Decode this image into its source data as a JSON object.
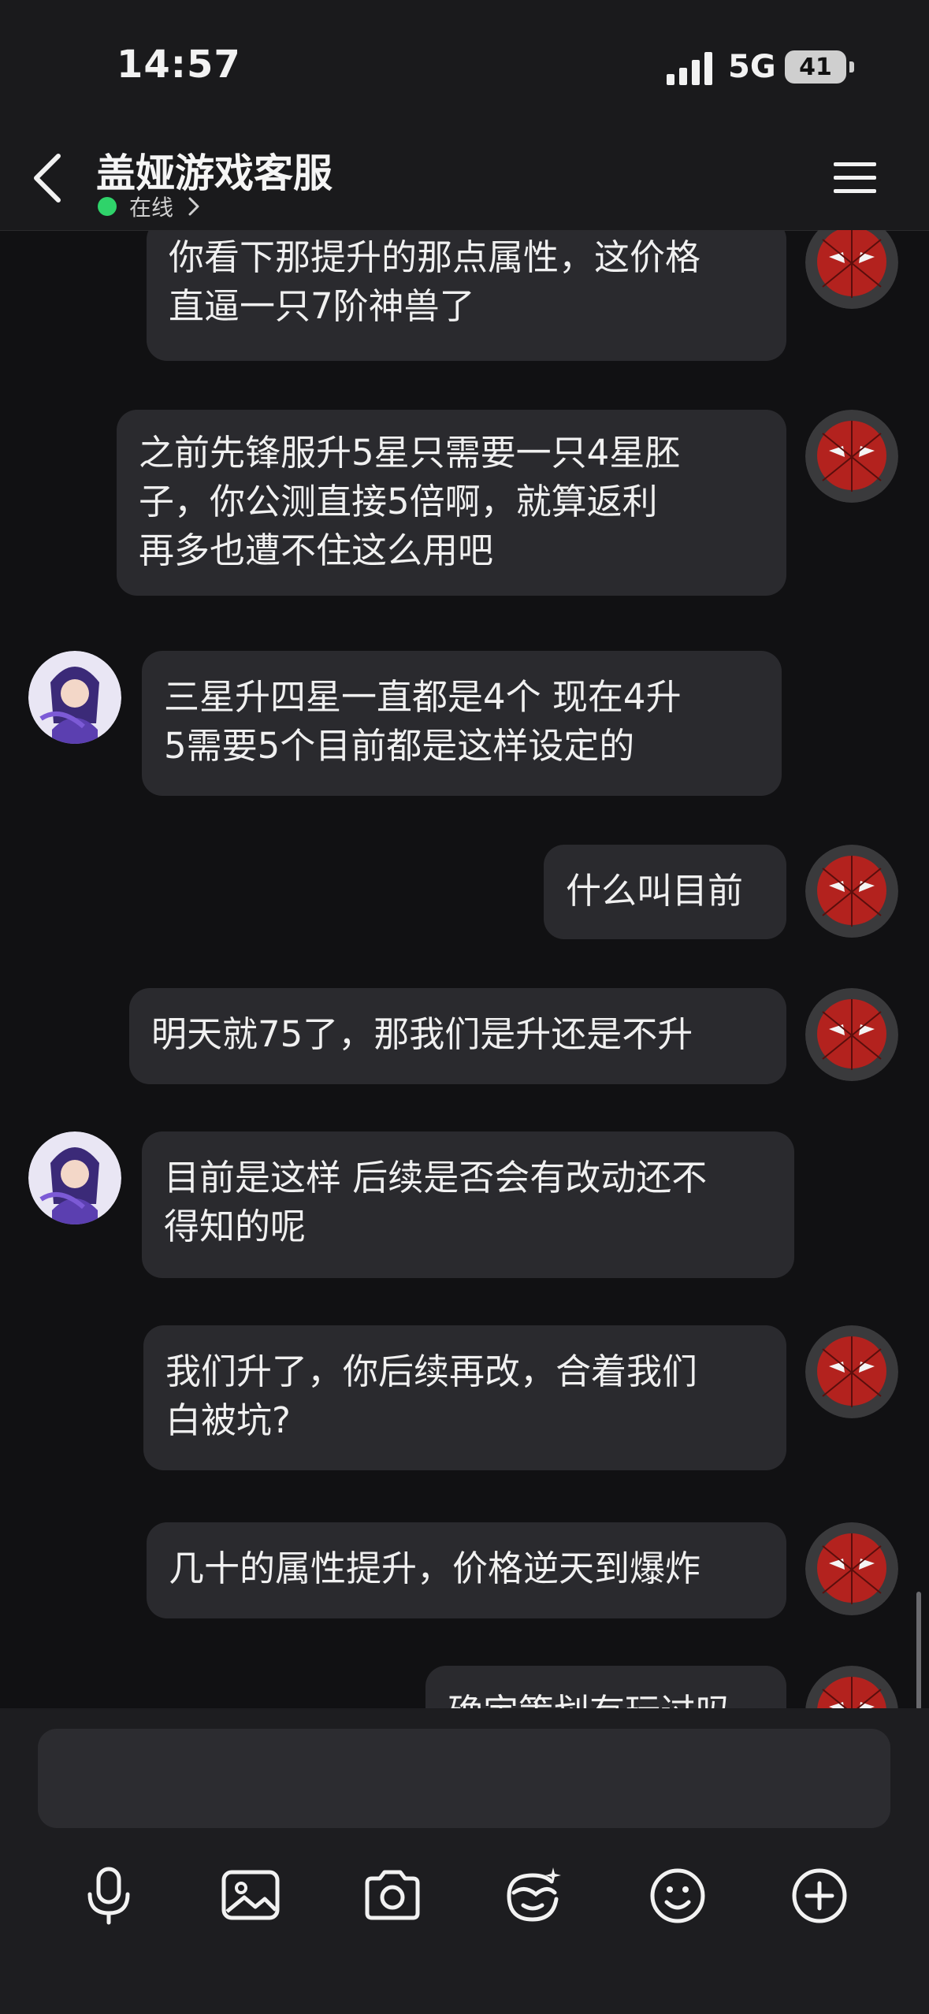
{
  "status_bar": {
    "time": "14:57",
    "network": "5G",
    "battery": "41"
  },
  "header": {
    "title": "盖娅游戏客服",
    "status": "在线"
  },
  "messages": [
    {
      "side": "right",
      "text": "你看下那提升的那点属性，这价格\n直逼一只7阶神兽了"
    },
    {
      "side": "right",
      "text": "之前先锋服升5星只需要一只4星胚\n子，你公测直接5倍啊，就算返利\n再多也遭不住这么用吧"
    },
    {
      "side": "left",
      "text": "三星升四星一直都是4个 现在4升\n5需要5个目前都是这样设定的"
    },
    {
      "side": "right",
      "text": "什么叫目前"
    },
    {
      "side": "right",
      "text": "明天就75了，那我们是升还是不升"
    },
    {
      "side": "left",
      "text": "目前是这样 后续是否会有改动还不\n得知的呢"
    },
    {
      "side": "right",
      "text": "我们升了，你后续再改，合着我们\n白被坑?"
    },
    {
      "side": "right",
      "text": "几十的属性提升，价格逆天到爆炸"
    },
    {
      "side": "right",
      "text": "确定策划有玩过吗"
    }
  ],
  "input": {
    "value": ""
  },
  "toolbar": {
    "icons": [
      "microphone-icon",
      "image-icon",
      "camera-icon",
      "sticker-icon",
      "emoji-icon",
      "plus-icon"
    ]
  },
  "colors": {
    "background": "#111113",
    "bubble": "#2a2a2e",
    "online": "#2fd36a"
  }
}
